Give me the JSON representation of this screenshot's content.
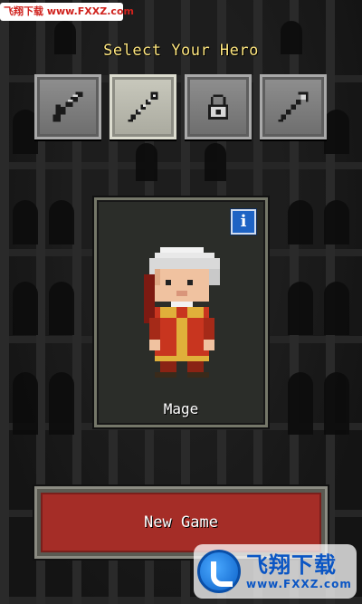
{
  "watermark": {
    "top_text": "飞翔下载 www.FXXZ.com",
    "logo_cn": "飞翔下载",
    "logo_url": "www.FXXZ.com"
  },
  "header": {
    "title": "Select Your Hero"
  },
  "classes": [
    {
      "id": "warrior",
      "icon": "sword-icon",
      "selected": false
    },
    {
      "id": "mage",
      "icon": "staff-icon",
      "selected": true
    },
    {
      "id": "rogue",
      "icon": "lock-icon",
      "selected": false
    },
    {
      "id": "huntress",
      "icon": "spear-icon",
      "selected": false
    }
  ],
  "hero": {
    "name": "Mage",
    "info_label": "i"
  },
  "actions": {
    "new_game_label": "New Game"
  },
  "colors": {
    "title": "#ffe780",
    "button_red": "#a52d27",
    "info_blue": "#1e63c4",
    "robe_red": "#c8351f",
    "hair_white": "#e8e8e8"
  }
}
